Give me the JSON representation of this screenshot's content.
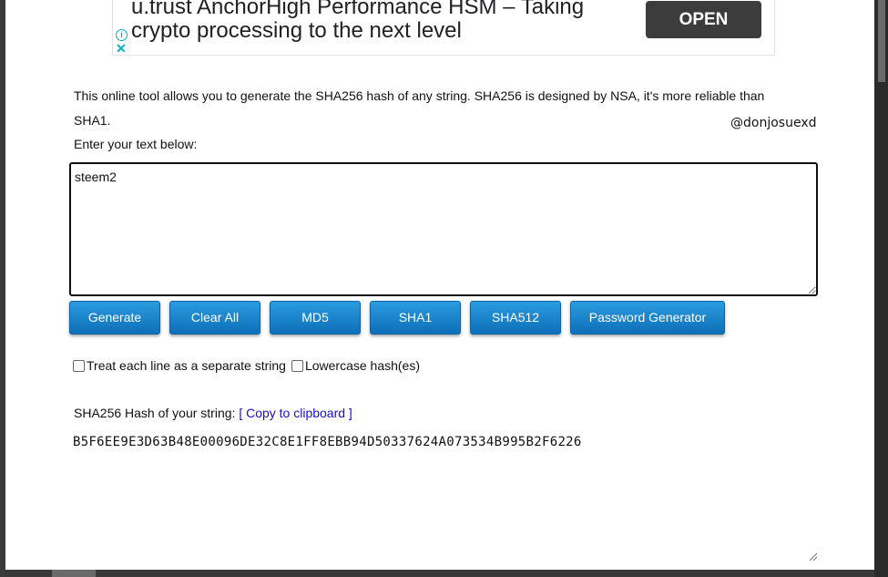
{
  "ad": {
    "text": "u.trust AnchorHigh Performance HSM – Taking crypto processing to the next level",
    "cta": "OPEN",
    "info_icon": "info-icon",
    "close_icon": "close-icon"
  },
  "description": "This online tool allows you to generate the SHA256 hash of any string. SHA256 is designed by NSA, it's more reliable than SHA1.",
  "handle": "@donjosuexd",
  "prompt": "Enter your text below:",
  "input": {
    "value": "steem2"
  },
  "buttons": {
    "generate": "Generate",
    "clear_all": "Clear All",
    "md5": "MD5",
    "sha1": "SHA1",
    "sha512": "SHA512",
    "password_generator": "Password Generator"
  },
  "options": {
    "each_line": "Treat each line as a separate string",
    "lowercase": "Lowercase hash(es)"
  },
  "result": {
    "label": "SHA256 Hash of your string: ",
    "copy": "[ Copy to clipboard ]",
    "hash": "B5F6EE9E3D63B48E00096DE32C8E1FF8EBB94D50337624A073534B995B2F6226"
  },
  "colors": {
    "button_top": "#2b9bdf",
    "button_bottom": "#0d6fb8",
    "link": "#1a0dcc",
    "ad_cta": "#3c3c3c"
  }
}
